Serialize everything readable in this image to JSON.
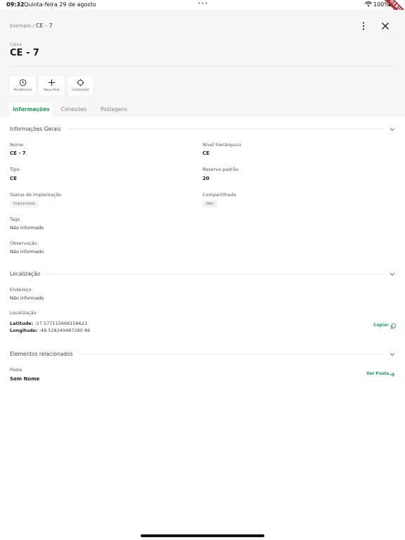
{
  "status_bar": {
    "time": "09:32",
    "date": "Quinta-feira 29 de agosto",
    "dots": "•••",
    "battery": "100%"
  },
  "debug_ribbon": "DEBUG",
  "header": {
    "breadcrumb_parent": "Exemplo /",
    "breadcrumb_current": "CE - 7",
    "type_caption": "Caixa",
    "title": "CE - 7"
  },
  "actions": [
    {
      "label": "Pendências",
      "icon": "clock-icon"
    },
    {
      "label": "Novo Post",
      "icon": "plus-icon"
    },
    {
      "label": "Centralizar",
      "icon": "crosshair-icon"
    }
  ],
  "tabs": [
    {
      "label": "Informações",
      "active": true
    },
    {
      "label": "Conexões",
      "active": false
    },
    {
      "label": "Postagens",
      "active": false
    }
  ],
  "general": {
    "title": "Informações Gerais",
    "nome_label": "Nome",
    "nome_value": "CE - 7",
    "nivel_label": "Nível hierárquico",
    "nivel_value": "CE",
    "tipo_label": "Tipo",
    "tipo_value": "CE",
    "reserva_label": "Reserva padrão",
    "reserva_value": "20",
    "status_label": "Status de implantação",
    "status_value": "Implantada",
    "compart_label": "Compartilhada",
    "compart_value": "Não",
    "tags_label": "Tags",
    "tags_value": "Não informado",
    "obs_label": "Observação",
    "obs_value": "Não informado"
  },
  "location": {
    "title": "Localização",
    "endereco_label": "Endereço",
    "endereco_value": "Não informado",
    "localizacao_label": "Localização",
    "lat_label": "Latitude:",
    "lat_value": "-27.577115668156623",
    "lng_label": "Longitude:",
    "lng_value": "-48.528249487280 86",
    "copy_label": "Copiar"
  },
  "related": {
    "title": "Elementos relacionados",
    "poste_label": "Poste",
    "poste_value": "Sem Nome",
    "view_label": "Ver Poste"
  },
  "colors": {
    "accent": "#1f9d57",
    "header_bg": "#f6f6f6",
    "debug": "#b0303a"
  }
}
